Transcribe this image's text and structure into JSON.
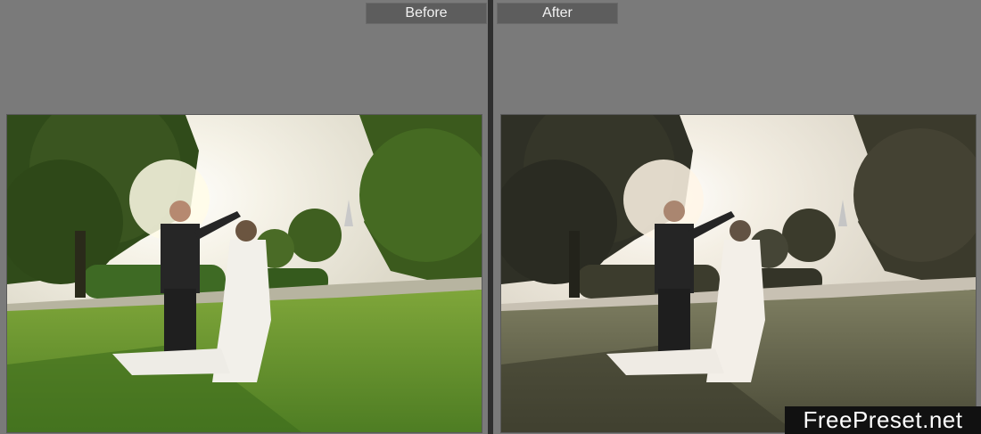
{
  "compare_view": {
    "before": {
      "label": "Before"
    },
    "after": {
      "label": "After"
    }
  },
  "watermark": {
    "text": "FreePreset.net"
  },
  "colors": {
    "panel_bg": "#7a7a7a",
    "divider": "#2f2f2f",
    "label_bg": "#5d5d5d",
    "label_text": "#f2f2f2",
    "watermark_bg": "#111111"
  }
}
